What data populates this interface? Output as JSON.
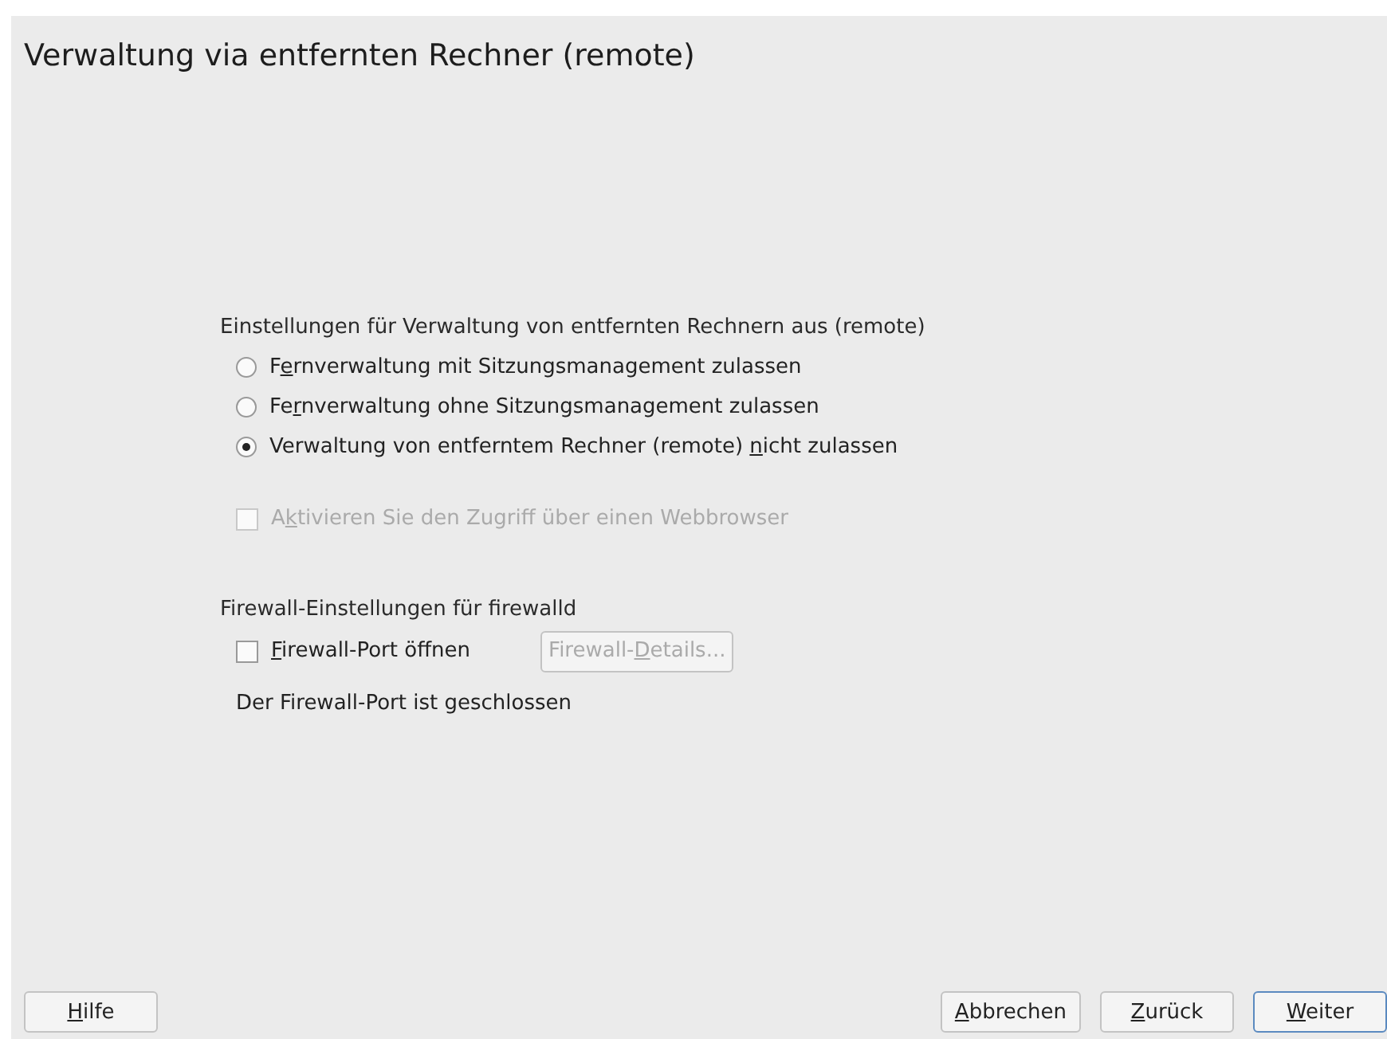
{
  "title": "Verwaltung via entfernten Rechner (remote)",
  "remote_group": {
    "heading": "Einstellungen für Verwaltung von entfernten Rechnern aus (remote)",
    "options": [
      {
        "before": "F",
        "mnemonic": "e",
        "after": "rnverwaltung mit Sitzungsmanagement zulassen",
        "selected": false
      },
      {
        "before": "Fe",
        "mnemonic": "r",
        "after": "nverwaltung ohne Sitzungsmanagement zulassen",
        "selected": false
      },
      {
        "before": "Verwaltung von entferntem Rechner (remote) ",
        "mnemonic": "n",
        "after": "icht zulassen",
        "selected": true
      }
    ],
    "web_checkbox": {
      "before": "A",
      "mnemonic": "k",
      "after": "tivieren Sie den Zugriff über einen Webbrowser",
      "checked": false,
      "disabled": true
    }
  },
  "firewall_group": {
    "heading": "Firewall-Einstellungen für firewalld",
    "port_checkbox": {
      "mnemonic": "F",
      "after": "irewall-Port öffnen",
      "checked": false,
      "disabled": false
    },
    "details_button": {
      "before": "Firewall-",
      "mnemonic": "D",
      "after": "etails...",
      "disabled": true
    },
    "status": "Der Firewall-Port ist geschlossen"
  },
  "help_button": {
    "mnemonic": "H",
    "after": "ilfe",
    "default": false
  },
  "buttons": [
    {
      "mnemonic": "A",
      "after": "bbrechen",
      "default": false
    },
    {
      "mnemonic": "Z",
      "after": "urück",
      "default": false
    },
    {
      "mnemonic": "W",
      "after": "eiter",
      "default": true
    }
  ]
}
